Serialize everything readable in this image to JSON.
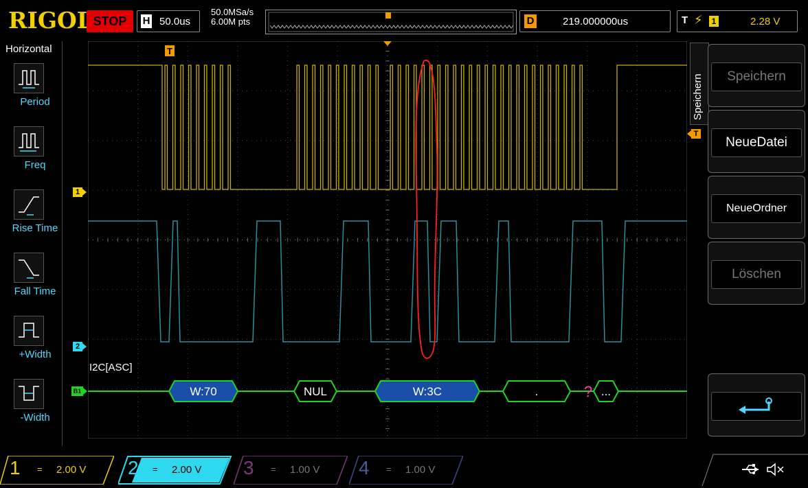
{
  "brand": "RIGOL",
  "run_state": "STOP",
  "horizontal": {
    "letter": "H",
    "timebase": "50.0us"
  },
  "acquisition": {
    "sample_rate": "50.0MSa/s",
    "memory_depth": "6.00M pts"
  },
  "delay": {
    "letter": "D",
    "value": "219.000000us"
  },
  "trigger": {
    "letter": "T",
    "edge_symbol": "†",
    "source": "1",
    "level": "2.28 V",
    "marker": "T"
  },
  "left_menu": {
    "title": "Horizontal",
    "items": [
      {
        "label": "Period",
        "icon": "period-icon"
      },
      {
        "label": "Freq",
        "icon": "frequency-icon"
      },
      {
        "label": "Rise Time",
        "icon": "rise-time-icon"
      },
      {
        "label": "Fall Time",
        "icon": "fall-time-icon"
      },
      {
        "label": "+Width",
        "icon": "positive-width-icon"
      },
      {
        "label": "-Width",
        "icon": "negative-width-icon"
      }
    ]
  },
  "right_menu": {
    "tab_title": "Speichern",
    "buttons": [
      {
        "label": "Speichern",
        "enabled": false
      },
      {
        "label": "NeueDatei",
        "enabled": true
      },
      {
        "label": "NeueOrdner",
        "enabled": true
      },
      {
        "label": "Löschen",
        "enabled": false
      },
      {
        "label": "",
        "icon": "return-icon",
        "enabled": true
      }
    ]
  },
  "decode": {
    "label": "I2C[ASC]",
    "bus_marker": "B1",
    "frames": [
      "W:70",
      "NUL",
      "W:3C",
      ".",
      "..."
    ],
    "error_symbol": "?"
  },
  "channel_markers": {
    "ch1": "1",
    "ch2": "2"
  },
  "channels": [
    {
      "num": "1",
      "coupling": "=",
      "scale": "2.00 V",
      "color": "#f0d000",
      "active": false
    },
    {
      "num": "2",
      "coupling": "=",
      "scale": "2.00 V",
      "color": "#2ed8ee",
      "active": true
    },
    {
      "num": "3",
      "coupling": "=",
      "scale": "1.00 V",
      "color": "#7a3a7a",
      "active": false
    },
    {
      "num": "4",
      "coupling": "=",
      "scale": "1.00 V",
      "color": "#3a4a8a",
      "active": false
    }
  ],
  "status_icons": [
    "usb-icon",
    "speaker-muted-icon"
  ],
  "colors": {
    "ch1": "#c7b000",
    "ch2": "#2b8f9e",
    "decode": "#1fd51f",
    "annotation": "#ff2020"
  }
}
